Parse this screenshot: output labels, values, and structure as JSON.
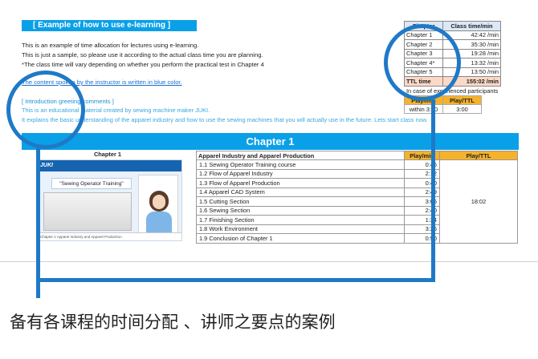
{
  "title": "[ Example of how to use e-learning ]",
  "intro": [
    "This is an example of time allocation for lectures using e-learning.",
    "This is just a sample, so please use it according to the actual class time you are planning.",
    "*The class time will vary depending on whether you perform the practical test in Chapter 4"
  ],
  "blue_note": "The content spoken by the instructor is written in blue color.",
  "greeting": {
    "title": "[ Introduction greeting comments ]",
    "lines": [
      "This is an educational material created by sewing machine maker JUKI.",
      "It explains the basic understanding of the apparel industry and how to use the sewing machines that you will actually use in the future. Lets start class now."
    ]
  },
  "class_table": {
    "headers": [
      "Chapter",
      "Class time/min"
    ],
    "rows": [
      [
        "Chapter 1",
        "42:42 /min"
      ],
      [
        "Chapter 2",
        "35:30 /min"
      ],
      [
        "Chapter 3",
        "19:28 /min"
      ],
      [
        "Chapter 4*",
        "13:32 /min"
      ],
      [
        "Chapter 5",
        "13:50 /min"
      ]
    ],
    "total": [
      "TTL time",
      "155:02 /min"
    ]
  },
  "experienced_note": "In case of experienced participants",
  "play_table": {
    "headers": [
      "Play/min",
      "Play/TTL"
    ],
    "row": [
      "within 3:00",
      "3:00"
    ]
  },
  "chapter_title": "Chapter 1",
  "chapter_left_header": "Chapter 1",
  "thumbnail": {
    "logo": "JUKI",
    "caption": "\"Sewing Operator Training\" course",
    "footer": "Chapter 1 Apparel Industry and Apparel Production"
  },
  "lessons": {
    "header_name": "Apparel Industry and Apparel Production",
    "header_play": "Play/min",
    "header_ttl": "Play/TTL",
    "ttl": "18:02",
    "rows": [
      [
        "1.1 Sewing Operator Training course",
        "0:46"
      ],
      [
        "1.2 Flow of Apparel Industry",
        "2:12"
      ],
      [
        "1.3 Flow of Apparel Production",
        "0:40"
      ],
      [
        "1.4 Apparel CAD System",
        "2:49"
      ],
      [
        "1.5 Cutting Section",
        "3:05"
      ],
      [
        "1.6 Sewing Section",
        "2:40"
      ],
      [
        "1.7 Finishing Section",
        "1:34"
      ],
      [
        "1.8 Work Environment",
        "3:26"
      ],
      [
        "1.9 Conclusion of Chapter 1",
        "0:50"
      ]
    ]
  },
  "caption": "备有各课程的时间分配 、讲师之要点的案例",
  "colors": {
    "accent": "#0aa0e8",
    "ring": "#1f79c7",
    "header_orange": "#f6b22a",
    "ttl_row": "#fbd9c6"
  }
}
